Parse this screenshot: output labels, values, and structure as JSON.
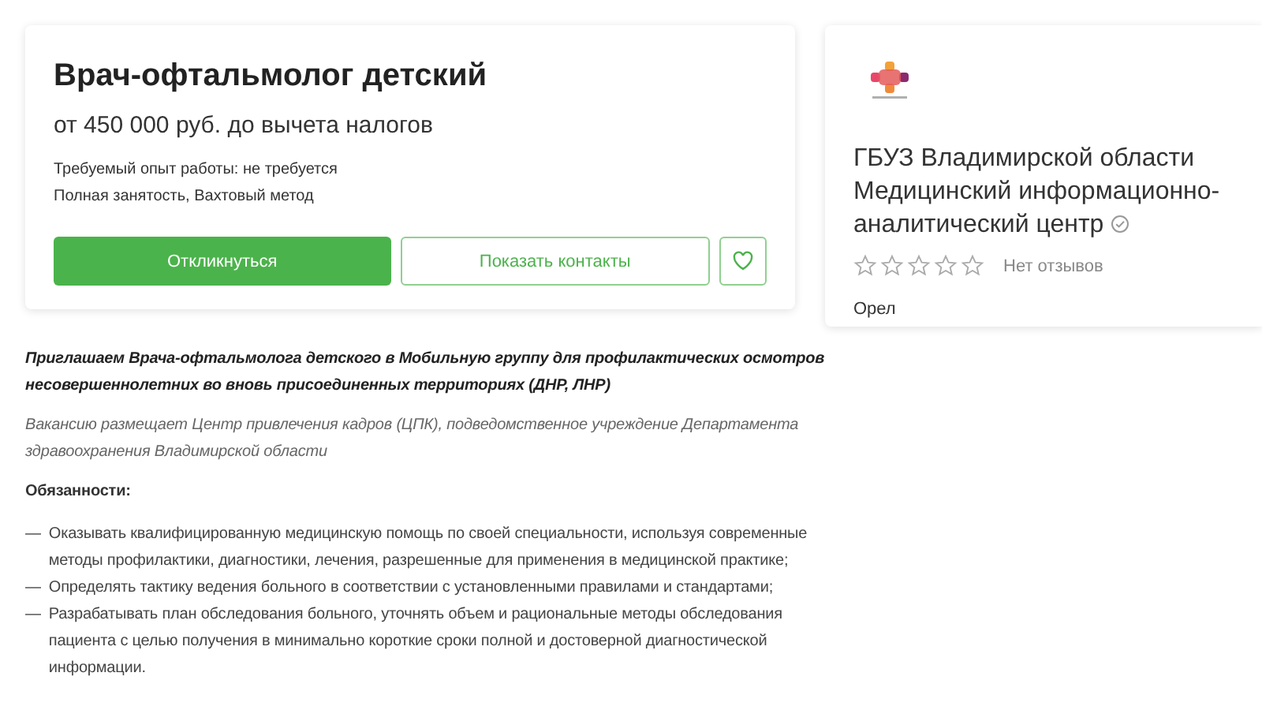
{
  "vacancy": {
    "title": "Врач-офтальмолог детский",
    "salary": "от 450 000 руб. до вычета налогов",
    "experience": "Требуемый опыт работы: не требуется",
    "employment": "Полная занятость, Вахтовый метод",
    "buttons": [
      {
        "kind": "primary",
        "label": "Откликнуться"
      },
      {
        "kind": "secondary",
        "label": "Показать контакты"
      },
      {
        "kind": "favorite"
      }
    ]
  },
  "employer": {
    "name": "ГБУЗ Владимирской области Медицинский информационно-аналитический центр",
    "verified": true,
    "stars": 0,
    "reviews": "Нет отзывов",
    "city": "Орел"
  },
  "description": {
    "intro": "Приглашаем Врача-офтальмолога детского в Мобильную группу для профилактических осмотров несовершеннолетних во вновь присоединенных территориях (ДНР, ЛНР)",
    "note": "Вакансию размещает Центр привлечения кадров (ЦПК), подведомственное учреждение Департамента здравоохранения Владимирской области",
    "heading": "Обязанности:",
    "items": [
      {
        "marker": "—",
        "text": "Оказывать квалифицированную медицинскую помощь по своей специальности, используя современные методы профилактики, диагностики, лечения, разрешенные для применения в медицинской практике;"
      },
      {
        "marker": "—",
        "text": "Определять тактику ведения больного в соответствии с установленными правилами и стандартами;"
      },
      {
        "marker": "—",
        "text": "Разрабатывать план обследования больного, уточнять объем и рациональные методы обследования пациента с целью получения в минимально короткие сроки полной и достоверной диагностической информации."
      }
    ]
  }
}
